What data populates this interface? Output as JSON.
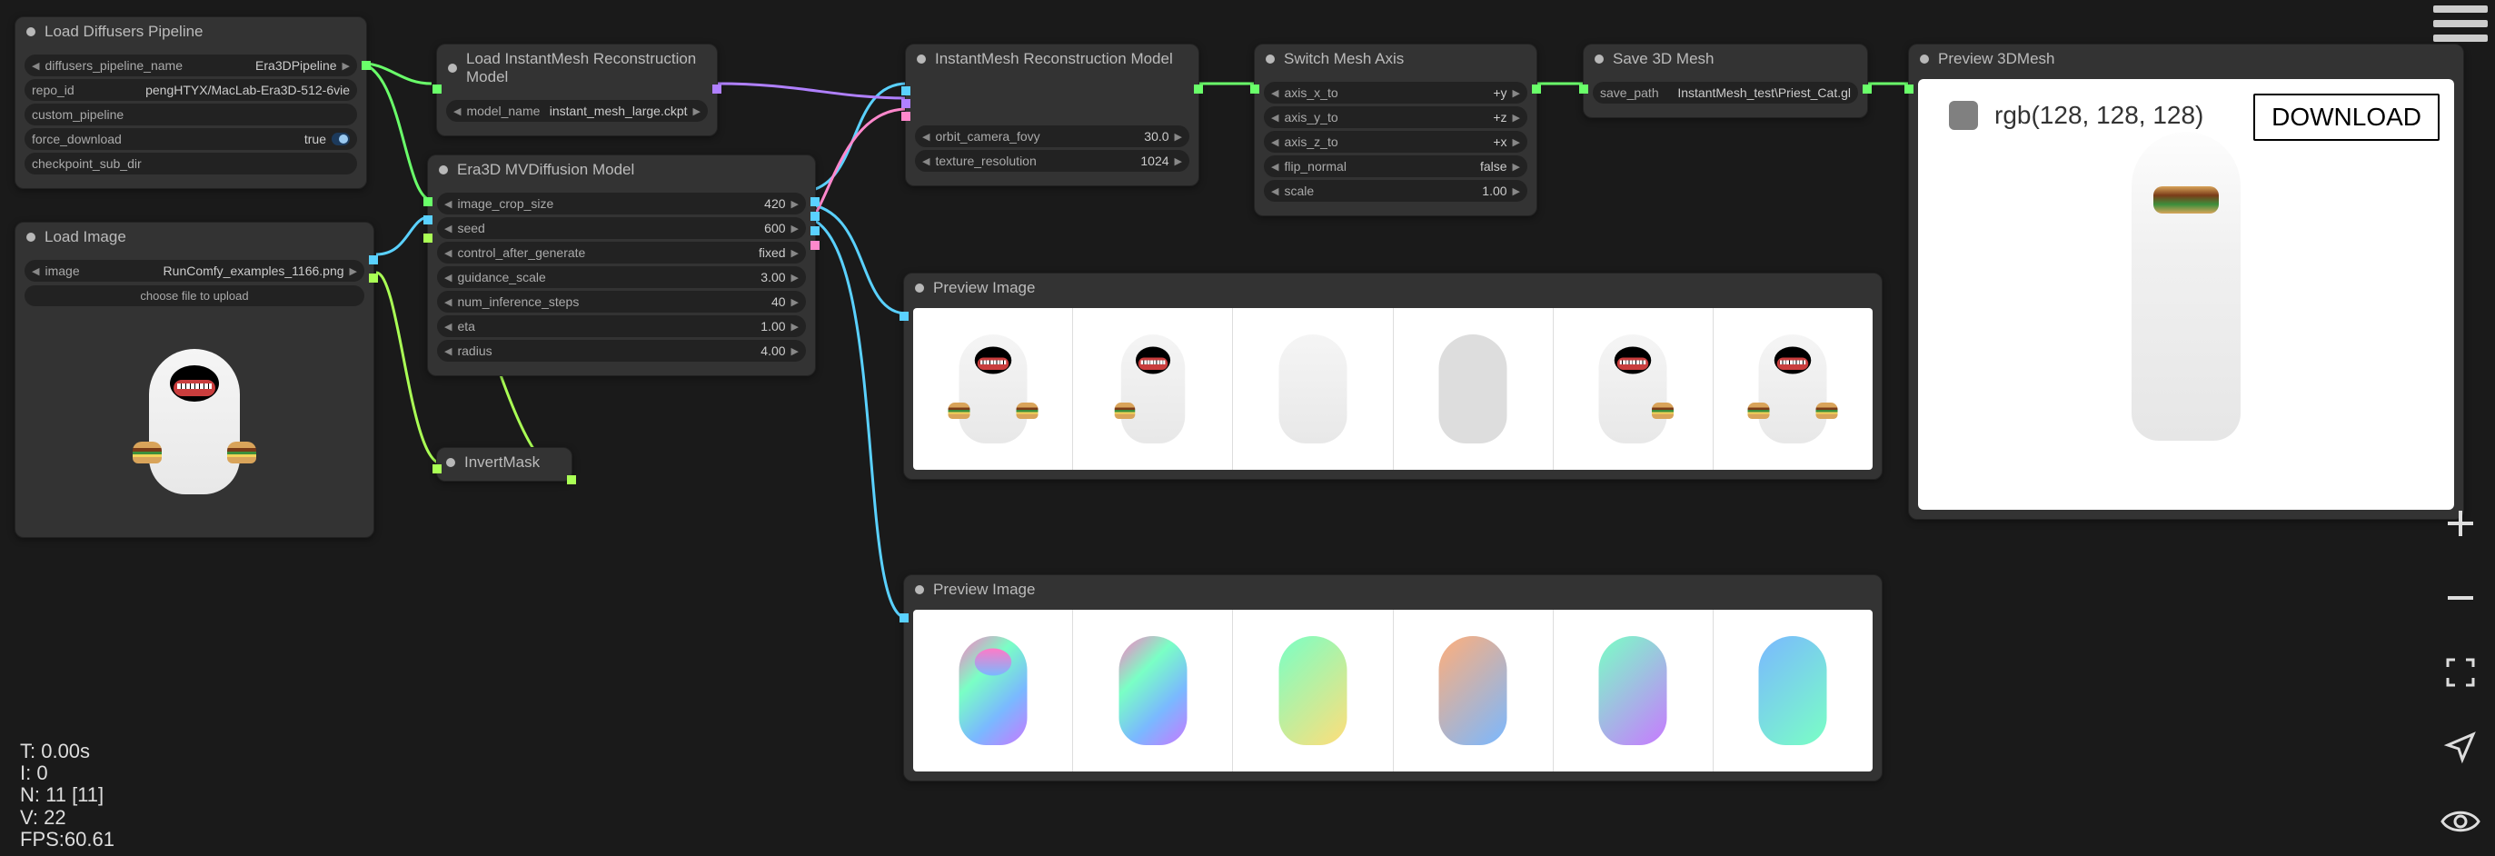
{
  "nodes": {
    "load_pipeline": {
      "title": "Load Diffusers Pipeline",
      "fields": {
        "name_label": "diffusers_pipeline_name",
        "name_value": "Era3DPipeline",
        "repo_label": "repo_id",
        "repo_value": "pengHTYX/MacLab-Era3D-512-6vie",
        "custom_label": "custom_pipeline",
        "force_label": "force_download",
        "force_value": "true",
        "ckpt_label": "checkpoint_sub_dir"
      }
    },
    "load_image": {
      "title": "Load Image",
      "image_label": "image",
      "image_value": "RunComfy_examples_1166.png",
      "upload_label": "choose file to upload"
    },
    "load_recon": {
      "title": "Load InstantMesh Reconstruction Model",
      "model_label": "model_name",
      "model_value": "instant_mesh_large.ckpt"
    },
    "mvdiff": {
      "title": "Era3D MVDiffusion Model",
      "crop_label": "image_crop_size",
      "crop_value": "420",
      "seed_label": "seed",
      "seed_value": "600",
      "ctrl_label": "control_after_generate",
      "ctrl_value": "fixed",
      "guidance_label": "guidance_scale",
      "guidance_value": "3.00",
      "steps_label": "num_inference_steps",
      "steps_value": "40",
      "eta_label": "eta",
      "eta_value": "1.00",
      "radius_label": "radius",
      "radius_value": "4.00"
    },
    "invertmask": {
      "title": "InvertMask"
    },
    "recon": {
      "title": "InstantMesh Reconstruction Model",
      "fovy_label": "orbit_camera_fovy",
      "fovy_value": "30.0",
      "tex_label": "texture_resolution",
      "tex_value": "1024"
    },
    "switch_axis": {
      "title": "Switch Mesh Axis",
      "x_label": "axis_x_to",
      "x_value": "+y",
      "y_label": "axis_y_to",
      "y_value": "+z",
      "z_label": "axis_z_to",
      "z_value": "+x",
      "flip_label": "flip_normal",
      "flip_value": "false",
      "scale_label": "scale",
      "scale_value": "1.00"
    },
    "save_mesh": {
      "title": "Save 3D Mesh",
      "path_label": "save_path",
      "path_value": "InstantMesh_test\\Priest_Cat.gl"
    },
    "preview_img1": {
      "title": "Preview Image"
    },
    "preview_img2": {
      "title": "Preview Image"
    },
    "preview_3d": {
      "title": "Preview 3DMesh",
      "color_text": "rgb(128, 128, 128)",
      "download_label": "DOWNLOAD"
    }
  },
  "stats": {
    "t": "T: 0.00s",
    "i": "I: 0",
    "n": "N: 11 [11]",
    "v": "V: 22",
    "fps": "FPS:60.61"
  }
}
